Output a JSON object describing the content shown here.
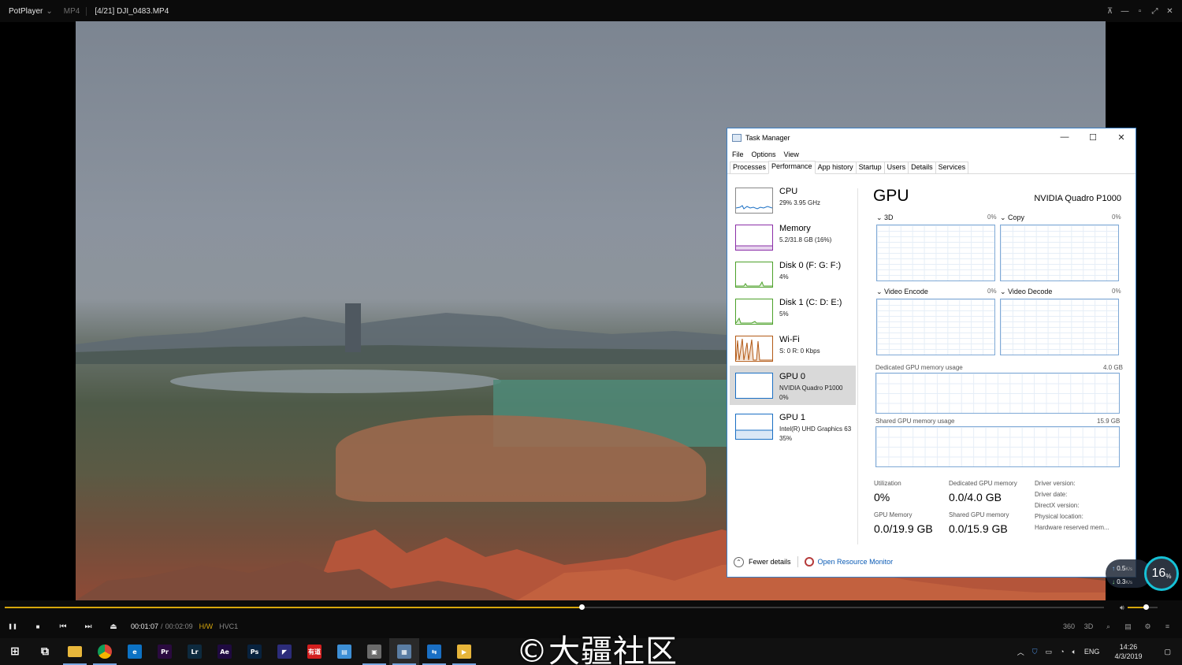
{
  "potplayer": {
    "app_name": "PotPlayer",
    "menu_arrow": "⌄",
    "format": "MP4",
    "file_title": "[4/21] DJI_0483.MP4",
    "window_icons": [
      "pin-icon",
      "minimize-icon",
      "restore-icon",
      "fullscreen-icon",
      "close-icon"
    ],
    "window_glyphs": [
      "⊼",
      "—",
      "▫",
      "⤢",
      "✕"
    ],
    "seek_progress": 0.525,
    "volume_level": 0.6,
    "time_current": "00:01:07",
    "time_sep": "/",
    "time_total": "00:02:09",
    "hw_label": "H/W",
    "codec_label": "HVC1",
    "transport_glyphs": [
      "❚❚",
      "■",
      "⏮",
      "⏭",
      "⏏"
    ],
    "right_buttons": [
      "360",
      "3D",
      "⌕",
      "▤",
      "⚙",
      "≡"
    ]
  },
  "task_manager": {
    "title": "Task Manager",
    "window_glyphs": [
      "—",
      "☐",
      "✕"
    ],
    "menu": [
      "File",
      "Options",
      "View"
    ],
    "tabs": [
      "Processes",
      "Performance",
      "App history",
      "Startup",
      "Users",
      "Details",
      "Services"
    ],
    "active_tab": "Performance",
    "sidebar": [
      {
        "name": "CPU",
        "sub1": "29% 3.95 GHz",
        "sub2": "",
        "color": "#1a6fc4"
      },
      {
        "name": "Memory",
        "sub1": "5.2/31.8 GB (16%)",
        "sub2": "",
        "color": "#8b2fa8"
      },
      {
        "name": "Disk 0 (F: G: F:)",
        "sub1": "4%",
        "sub2": "",
        "color": "#4ca12a"
      },
      {
        "name": "Disk 1 (C: D: E:)",
        "sub1": "5%",
        "sub2": "",
        "color": "#4ca12a"
      },
      {
        "name": "Wi-Fi",
        "sub1": "S: 0 R: 0 Kbps",
        "sub2": "",
        "color": "#b35a16"
      },
      {
        "name": "GPU 0",
        "sub1": "NVIDIA Quadro P1000",
        "sub2": "0%",
        "color": "#1a6fc4"
      },
      {
        "name": "GPU 1",
        "sub1": "Intel(R) UHD Graphics 63",
        "sub2": "35%",
        "color": "#1a6fc4"
      }
    ],
    "gpu": {
      "title": "GPU",
      "model": "NVIDIA Quadro P1000",
      "engines": [
        {
          "label": "3D",
          "pct": "0%"
        },
        {
          "label": "Copy",
          "pct": "0%"
        },
        {
          "label": "Video Encode",
          "pct": "0%"
        },
        {
          "label": "Video Decode",
          "pct": "0%"
        }
      ],
      "dedicated_label": "Dedicated GPU memory usage",
      "dedicated_max": "4.0 GB",
      "shared_label": "Shared GPU memory usage",
      "shared_max": "15.9 GB",
      "stats": {
        "utilization_label": "Utilization",
        "utilization_value": "0%",
        "dedicated_mem_label": "Dedicated GPU memory",
        "dedicated_mem_value": "0.0/4.0 GB",
        "gpu_memory_label": "GPU Memory",
        "gpu_memory_value": "0.0/19.9 GB",
        "shared_mem_label": "Shared GPU memory",
        "shared_mem_value": "0.0/15.9 GB",
        "driver_version": "Driver version:",
        "driver_date": "Driver date:",
        "directx_version": "DirectX version:",
        "physical_location": "Physical location:",
        "hardware_reserved": "Hardware reserved mem..."
      }
    },
    "footer": {
      "fewer_details": "Fewer details",
      "open_resource_monitor": "Open Resource Monitor"
    }
  },
  "net_widget": {
    "upload": "0.5",
    "upload_unit": "K/s",
    "download": "0.3",
    "download_unit": "K/s",
    "percent": "16",
    "percent_sign": "%"
  },
  "taskbar": {
    "apps": [
      {
        "icon": "windows-start-icon",
        "glyph": "⊞",
        "bg": "transparent"
      },
      {
        "icon": "task-view-icon",
        "glyph": "⧉",
        "bg": "transparent"
      },
      {
        "icon": "file-explorer-icon",
        "glyph": "",
        "bg": "#e8b73b"
      },
      {
        "icon": "chrome-icon",
        "glyph": "",
        "bg": "#db4437"
      },
      {
        "icon": "edge-icon",
        "glyph": "e",
        "bg": "#0c72c4"
      },
      {
        "icon": "premiere-pro-icon",
        "glyph": "Pr",
        "bg": "#2a0a3f"
      },
      {
        "icon": "lightroom-icon",
        "glyph": "Lr",
        "bg": "#0d2a3e"
      },
      {
        "icon": "after-effects-icon",
        "glyph": "Ae",
        "bg": "#1f0a40"
      },
      {
        "icon": "photoshop-icon",
        "glyph": "Ps",
        "bg": "#08223e"
      },
      {
        "icon": "media-encoder-icon",
        "glyph": "◤",
        "bg": "#2c2c7a"
      },
      {
        "icon": "red-app-icon",
        "glyph": "有道",
        "bg": "#d21e1e"
      },
      {
        "icon": "news-app-icon",
        "glyph": "▤",
        "bg": "#3d8fd6"
      },
      {
        "icon": "gpu-tool-icon",
        "glyph": "▣",
        "bg": "#6b6b6b"
      },
      {
        "icon": "task-manager-icon",
        "glyph": "▦",
        "bg": "#5a7da3"
      },
      {
        "icon": "teamviewer-icon",
        "glyph": "⇆",
        "bg": "#1a6fc4"
      },
      {
        "icon": "potplayer-icon",
        "glyph": "▶",
        "bg": "#e7b53a"
      }
    ],
    "tray": {
      "chevron": "︿",
      "lang": "ENG",
      "time": "14:26",
      "date": "4/3/2019"
    }
  },
  "watermark": "©大疆社区"
}
